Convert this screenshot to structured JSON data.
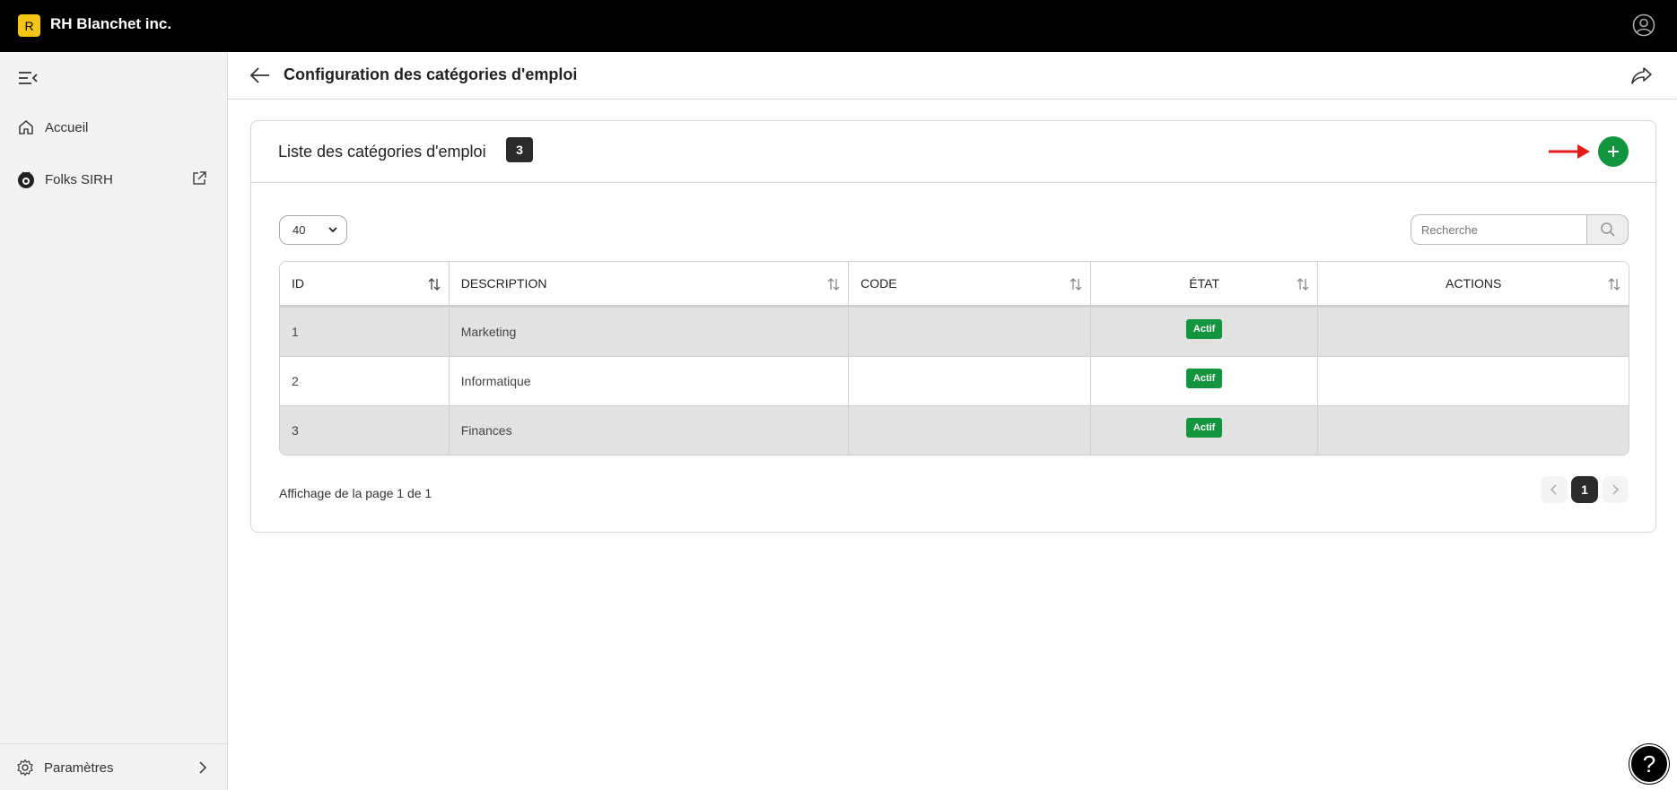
{
  "app": {
    "logo_letter": "R",
    "company_name": "RH Blanchet inc."
  },
  "sidebar": {
    "items": [
      {
        "label": "Accueil",
        "icon": "home-icon"
      },
      {
        "label": "Folks SIRH",
        "icon": "folks-logo-icon",
        "external": true
      }
    ],
    "settings_label": "Paramètres"
  },
  "header": {
    "title": "Configuration des catégories d'emploi"
  },
  "card": {
    "title": "Liste des catégories d'emploi",
    "count": "3",
    "page_size": "40",
    "search_placeholder": "Recherche"
  },
  "table": {
    "columns": [
      "ID",
      "DESCRIPTION",
      "CODE",
      "ÉTAT",
      "ACTIONS"
    ],
    "rows": [
      {
        "id": "1",
        "description": "Marketing",
        "code": "",
        "state": "Actif",
        "actions": ""
      },
      {
        "id": "2",
        "description": "Informatique",
        "code": "",
        "state": "Actif",
        "actions": ""
      },
      {
        "id": "3",
        "description": "Finances",
        "code": "",
        "state": "Actif",
        "actions": ""
      }
    ]
  },
  "pagination": {
    "info": "Affichage de la page 1 de 1",
    "current": "1"
  },
  "help": {
    "label": "?"
  },
  "colors": {
    "topbar": "#000000",
    "accent_yellow": "#f5c518",
    "success_green": "#12953e",
    "annotation_red": "#e31b1b"
  }
}
